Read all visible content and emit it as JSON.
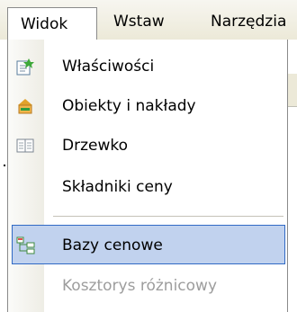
{
  "menubar": {
    "items": [
      {
        "label": "Widok"
      },
      {
        "label": "Wstaw"
      },
      {
        "label": "Narzędzia"
      }
    ]
  },
  "menu": {
    "items": [
      {
        "label": "Właściwości",
        "icon": "properties-icon"
      },
      {
        "label": "Obiekty i nakłady",
        "icon": "objects-icon"
      },
      {
        "label": "Drzewko",
        "icon": "tree-icon"
      },
      {
        "label": "Składniki ceny",
        "icon": ""
      },
      {
        "label": "Bazy cenowe",
        "icon": "price-bases-icon",
        "state": "selected"
      },
      {
        "label": "Kosztorys różnicowy",
        "icon": "",
        "state": "disabled"
      }
    ]
  },
  "colors": {
    "menubar_bg": "#ece9d8",
    "highlight_bg": "#c1d2ee",
    "highlight_border": "#316ac5",
    "disabled_text": "#9d9d9d"
  }
}
